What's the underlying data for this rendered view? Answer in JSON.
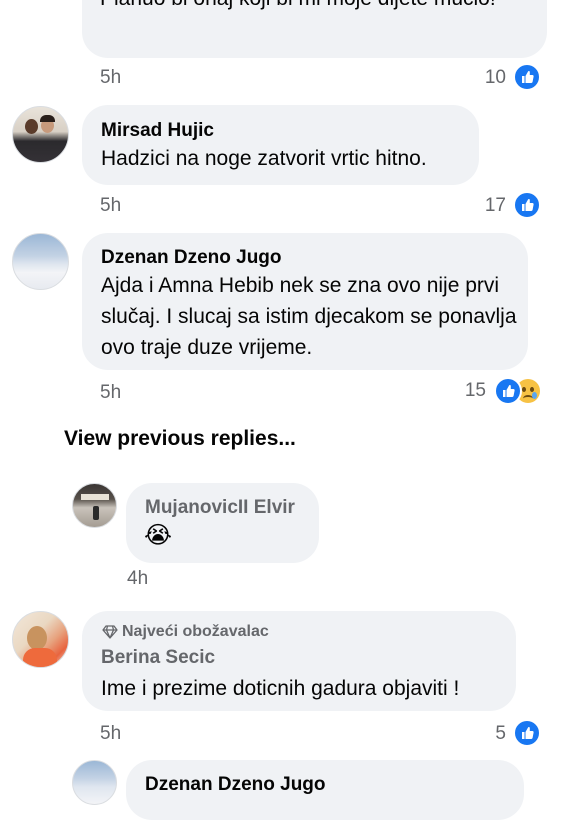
{
  "comments": [
    {
      "text": "Planuo bi onaj koji bi mi moje dijete mucio!",
      "time": "5h",
      "likes": "10"
    },
    {
      "author": "Mirsad Hujic",
      "text": "Hadzici na noge zatvorit vrtic hitno.",
      "time": "5h",
      "likes": "17"
    },
    {
      "author": "Dzenan Dzeno Jugo",
      "text": "Ajda i Amna Hebib nek se zna ovo nije prvi slučaj. I slucaj sa istim djecakom se ponavlja ovo traje duze vrijeme.",
      "time": "5h",
      "likes": "15"
    }
  ],
  "view_previous_replies": "View previous replies...",
  "reply1": {
    "author": "MujanovicII Elvir",
    "emoji": "😭",
    "time": "4h"
  },
  "comment4": {
    "badge": "Najveći obožavalac",
    "author": "Berina Secic",
    "text": "Ime i prezime doticnih gadura objaviti !",
    "time": "5h",
    "likes": "5"
  },
  "reply2": {
    "author": "Dzenan Dzeno Jugo"
  },
  "colors": {
    "bubble": "#f0f2f5",
    "like_blue": "#1877f2",
    "meta_gray": "#65676b",
    "text": "#050505"
  },
  "icons": [
    "like-icon",
    "sad-icon",
    "diamond-icon"
  ]
}
